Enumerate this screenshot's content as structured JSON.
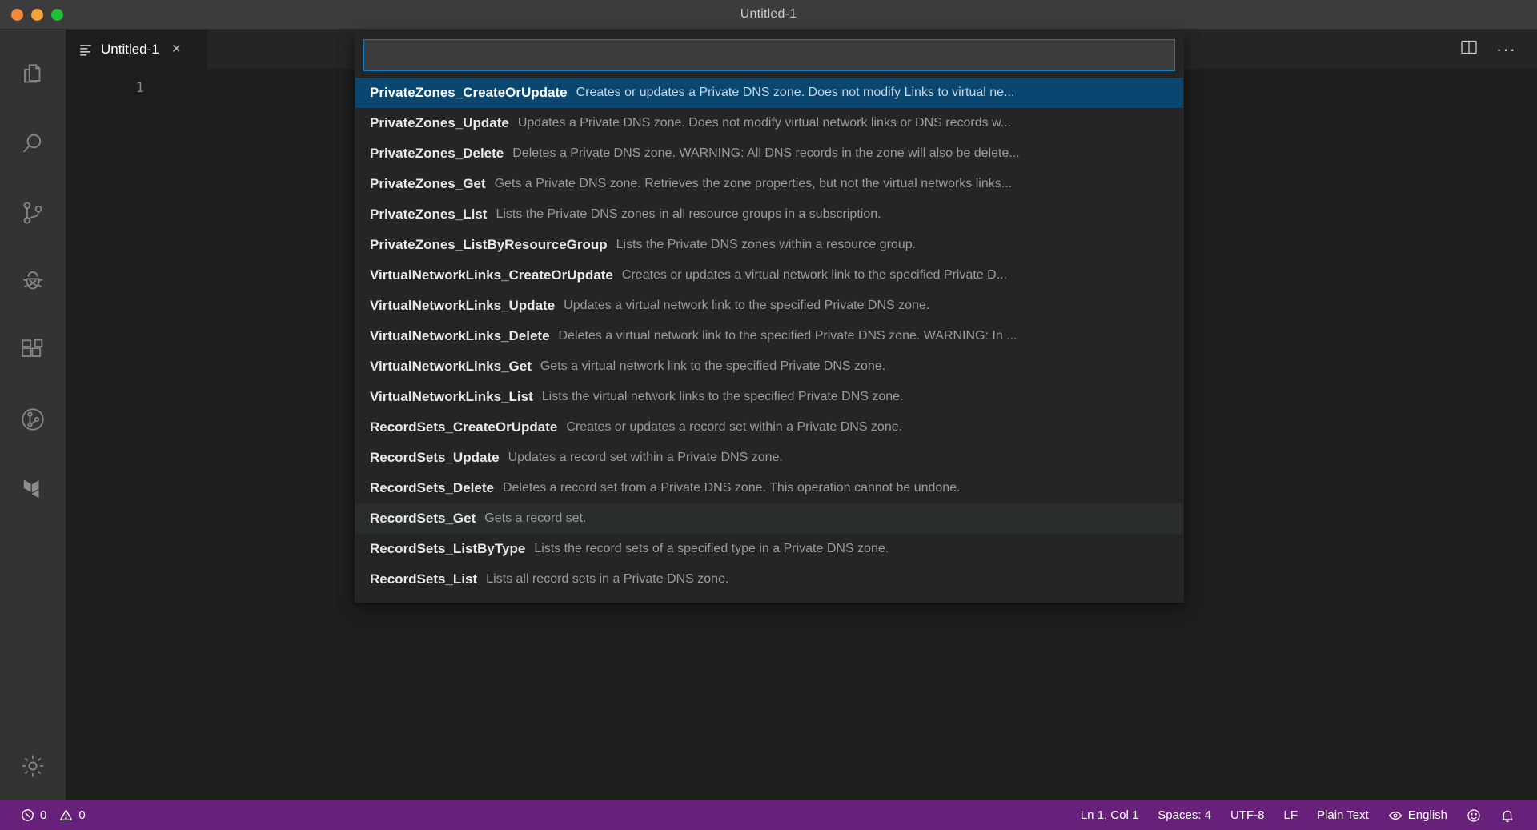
{
  "window": {
    "title": "Untitled-1",
    "traffic_lights": [
      "close",
      "minimize",
      "maximize"
    ]
  },
  "activity_bar": {
    "items": [
      {
        "name": "explorer",
        "icon": "files-icon",
        "active": false
      },
      {
        "name": "search",
        "icon": "search-icon",
        "active": false
      },
      {
        "name": "source-control",
        "icon": "source-control-icon",
        "active": false
      },
      {
        "name": "run-and-debug",
        "icon": "debug-icon",
        "active": false
      },
      {
        "name": "extensions",
        "icon": "extensions-icon",
        "active": false
      },
      {
        "name": "azure-pipelines",
        "icon": "azure-pipelines-icon",
        "active": false
      },
      {
        "name": "terraform",
        "icon": "terraform-icon",
        "active": false
      }
    ],
    "bottom_items": [
      {
        "name": "manage-settings",
        "icon": "gear-icon"
      }
    ]
  },
  "editor": {
    "tab": {
      "label": "Untitled-1",
      "icon": "file-lines-icon",
      "close": "×"
    },
    "actions": {
      "split_editor": "split-editor-icon",
      "more_actions": "···"
    },
    "line_numbers": [
      "1"
    ],
    "content": ""
  },
  "quick_pick": {
    "input_value": "",
    "placeholder": "",
    "items": [
      {
        "label": "PrivateZones_CreateOrUpdate",
        "description": "Creates or updates a Private DNS zone. Does not modify Links to virtual ne...",
        "state": "selected"
      },
      {
        "label": "PrivateZones_Update",
        "description": "Updates a Private DNS zone. Does not modify virtual network links or DNS records w...",
        "state": "normal"
      },
      {
        "label": "PrivateZones_Delete",
        "description": "Deletes a Private DNS zone. WARNING: All DNS records in the zone will also be delete...",
        "state": "normal"
      },
      {
        "label": "PrivateZones_Get",
        "description": "Gets a Private DNS zone. Retrieves the zone properties, but not the virtual networks links...",
        "state": "normal"
      },
      {
        "label": "PrivateZones_List",
        "description": "Lists the Private DNS zones in all resource groups in a subscription.",
        "state": "normal"
      },
      {
        "label": "PrivateZones_ListByResourceGroup",
        "description": "Lists the Private DNS zones within a resource group.",
        "state": "normal"
      },
      {
        "label": "VirtualNetworkLinks_CreateOrUpdate",
        "description": "Creates or updates a virtual network link to the specified Private D...",
        "state": "normal"
      },
      {
        "label": "VirtualNetworkLinks_Update",
        "description": "Updates a virtual network link to the specified Private DNS zone.",
        "state": "normal"
      },
      {
        "label": "VirtualNetworkLinks_Delete",
        "description": "Deletes a virtual network link to the specified Private DNS zone. WARNING: In ...",
        "state": "normal"
      },
      {
        "label": "VirtualNetworkLinks_Get",
        "description": "Gets a virtual network link to the specified Private DNS zone.",
        "state": "normal"
      },
      {
        "label": "VirtualNetworkLinks_List",
        "description": "Lists the virtual network links to the specified Private DNS zone.",
        "state": "normal"
      },
      {
        "label": "RecordSets_CreateOrUpdate",
        "description": "Creates or updates a record set within a Private DNS zone.",
        "state": "normal"
      },
      {
        "label": "RecordSets_Update",
        "description": "Updates a record set within a Private DNS zone.",
        "state": "normal"
      },
      {
        "label": "RecordSets_Delete",
        "description": "Deletes a record set from a Private DNS zone. This operation cannot be undone.",
        "state": "normal"
      },
      {
        "label": "RecordSets_Get",
        "description": "Gets a record set.",
        "state": "hovered"
      },
      {
        "label": "RecordSets_ListByType",
        "description": "Lists the record sets of a specified type in a Private DNS zone.",
        "state": "normal"
      },
      {
        "label": "RecordSets_List",
        "description": "Lists all record sets in a Private DNS zone.",
        "state": "normal"
      }
    ]
  },
  "status_bar": {
    "left": [
      {
        "name": "errors",
        "icon": "error-icon",
        "text": "0"
      },
      {
        "name": "warnings",
        "icon": "warning-icon",
        "text": "0"
      }
    ],
    "right": [
      {
        "name": "cursor-position",
        "text": "Ln 1, Col 1"
      },
      {
        "name": "indentation",
        "text": "Spaces: 4"
      },
      {
        "name": "encoding",
        "text": "UTF-8"
      },
      {
        "name": "end-of-line",
        "text": "LF"
      },
      {
        "name": "language-mode",
        "text": "Plain Text"
      },
      {
        "name": "spell-checker",
        "icon": "eye-icon",
        "text": "English"
      },
      {
        "name": "feedback",
        "icon": "smiley-icon",
        "text": ""
      },
      {
        "name": "notifications",
        "icon": "bell-icon",
        "text": ""
      }
    ],
    "background_color": "#68217a"
  },
  "colors": {
    "accent": "#007fd4",
    "selection": "#094771",
    "status_bar": "#68217a",
    "editor_bg": "#1e1e1e",
    "sidebar_bg": "#333333"
  }
}
